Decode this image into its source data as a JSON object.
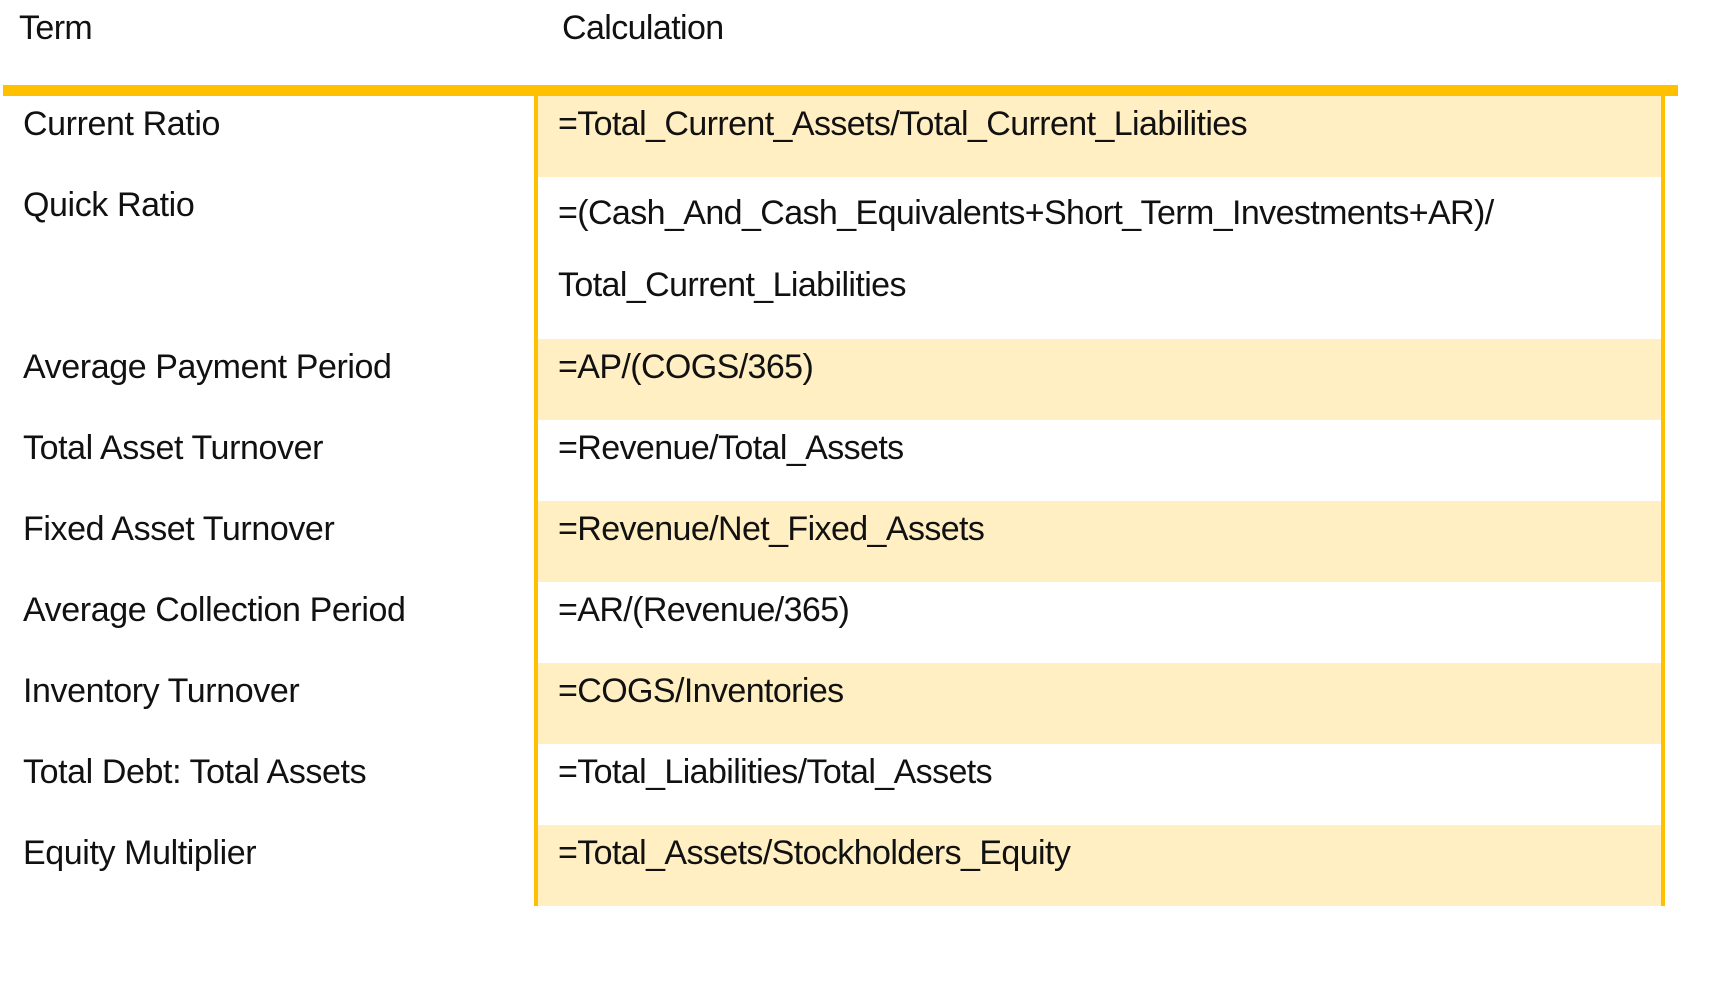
{
  "colors": {
    "accent": "#FFC000",
    "shaded_row": "#FFEFC2",
    "background": "#FFFFFF",
    "text": "#111111"
  },
  "table": {
    "headers": {
      "term": "Term",
      "calculation": "Calculation"
    },
    "rows": [
      {
        "term": "Current Ratio",
        "calculation": "=Total_Current_Assets/Total_Current_Liabilities",
        "shaded": true
      },
      {
        "term": "Quick Ratio",
        "calculation": "=(Cash_And_Cash_Equivalents+Short_Term_Investments+AR)/ Total_Current_Liabilities",
        "shaded": false
      },
      {
        "term": "Average Payment Period",
        "calculation": "=AP/(COGS/365)",
        "shaded": true
      },
      {
        "term": "Total Asset Turnover",
        "calculation": "=Revenue/Total_Assets",
        "shaded": false
      },
      {
        "term": "Fixed Asset Turnover",
        "calculation": "=Revenue/Net_Fixed_Assets",
        "shaded": true
      },
      {
        "term": "Average Collection Period",
        "calculation": "=AR/(Revenue/365)",
        "shaded": false
      },
      {
        "term": "Inventory Turnover",
        "calculation": "=COGS/Inventories",
        "shaded": true
      },
      {
        "term": "Total Debt: Total Assets",
        "calculation": "=Total_Liabilities/Total_Assets",
        "shaded": false
      },
      {
        "term": "Equity Multiplier",
        "calculation": "=Total_Assets/Stockholders_Equity",
        "shaded": true
      }
    ]
  }
}
